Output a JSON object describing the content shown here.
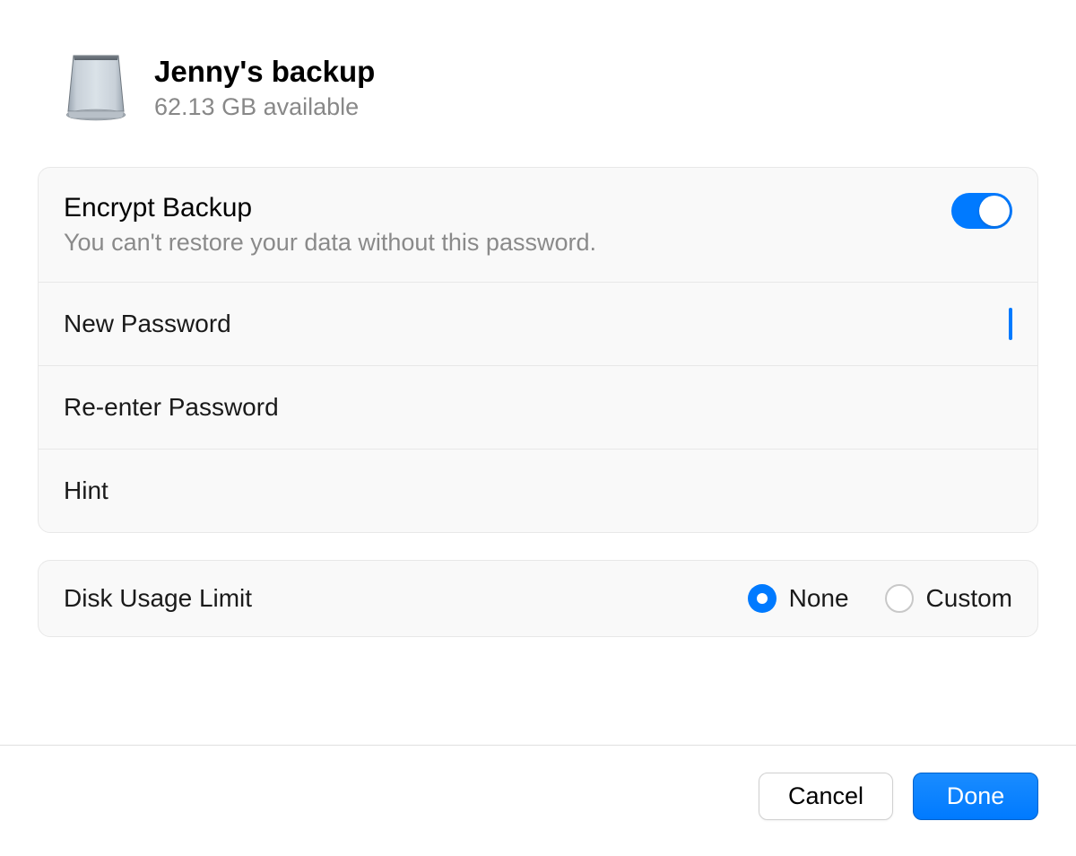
{
  "disk": {
    "name": "Jenny's backup",
    "available": "62.13 GB available"
  },
  "encrypt": {
    "title": "Encrypt Backup",
    "subtitle": "You can't restore your data without this password.",
    "enabled": true
  },
  "fields": {
    "new_password_label": "New Password",
    "reenter_password_label": "Re-enter Password",
    "hint_label": "Hint"
  },
  "disk_usage": {
    "label": "Disk Usage Limit",
    "options": {
      "none": "None",
      "custom": "Custom"
    },
    "selected": "none"
  },
  "buttons": {
    "cancel": "Cancel",
    "done": "Done"
  }
}
